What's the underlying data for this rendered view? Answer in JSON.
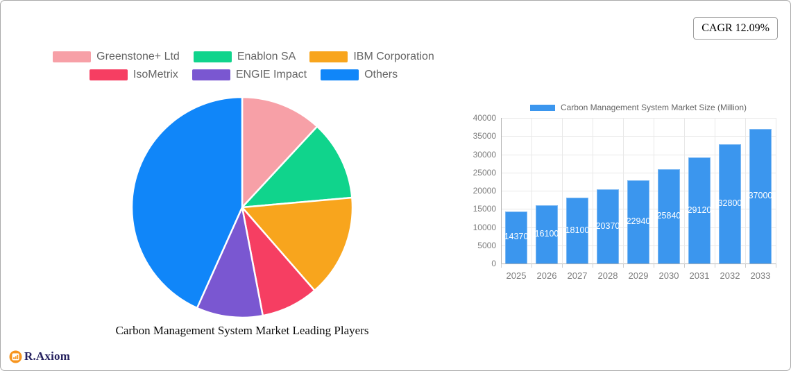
{
  "header": {
    "cagr_badge": "CAGR 12.09%"
  },
  "brand": {
    "name": "R.Axiom",
    "icon_color": "#f7941d",
    "text_color": "#26225f"
  },
  "chart_data": [
    {
      "type": "pie",
      "title": "Carbon Management System Market Leading Players",
      "labels": [
        "Greenstone+ Ltd",
        "Enablon SA",
        "IBM Corporation",
        "IsoMetrix",
        "ENGIE Impact",
        "Others"
      ],
      "values_percent": [
        11.9,
        11.7,
        15.0,
        8.4,
        9.7,
        43.3
      ],
      "colors": [
        "#f7a0a7",
        "#10d48c",
        "#f8a51d",
        "#f63e62",
        "#7a57d1",
        "#1086f9"
      ],
      "start_angle": "12-oclock-clockwise",
      "legend_position": "top",
      "legend_rows": 2,
      "slice_border_color": "#ffffff"
    },
    {
      "type": "bar",
      "legend_label": "Carbon Management System Market Size (Million)",
      "categories": [
        "2025",
        "2026",
        "2027",
        "2028",
        "2029",
        "2030",
        "2031",
        "2032",
        "2033"
      ],
      "values": [
        14370,
        16100,
        18100,
        20370,
        22940,
        25840,
        29120,
        32800,
        37000
      ],
      "ylim": [
        0,
        40000
      ],
      "ytick_step": 5000,
      "grid": true,
      "bar_color": "#3b96ee",
      "bar_border_color": "#7db9f3",
      "value_label_color": "#ffffff",
      "axis_label_color": "#7b7b7b",
      "legend_position": "top"
    }
  ]
}
